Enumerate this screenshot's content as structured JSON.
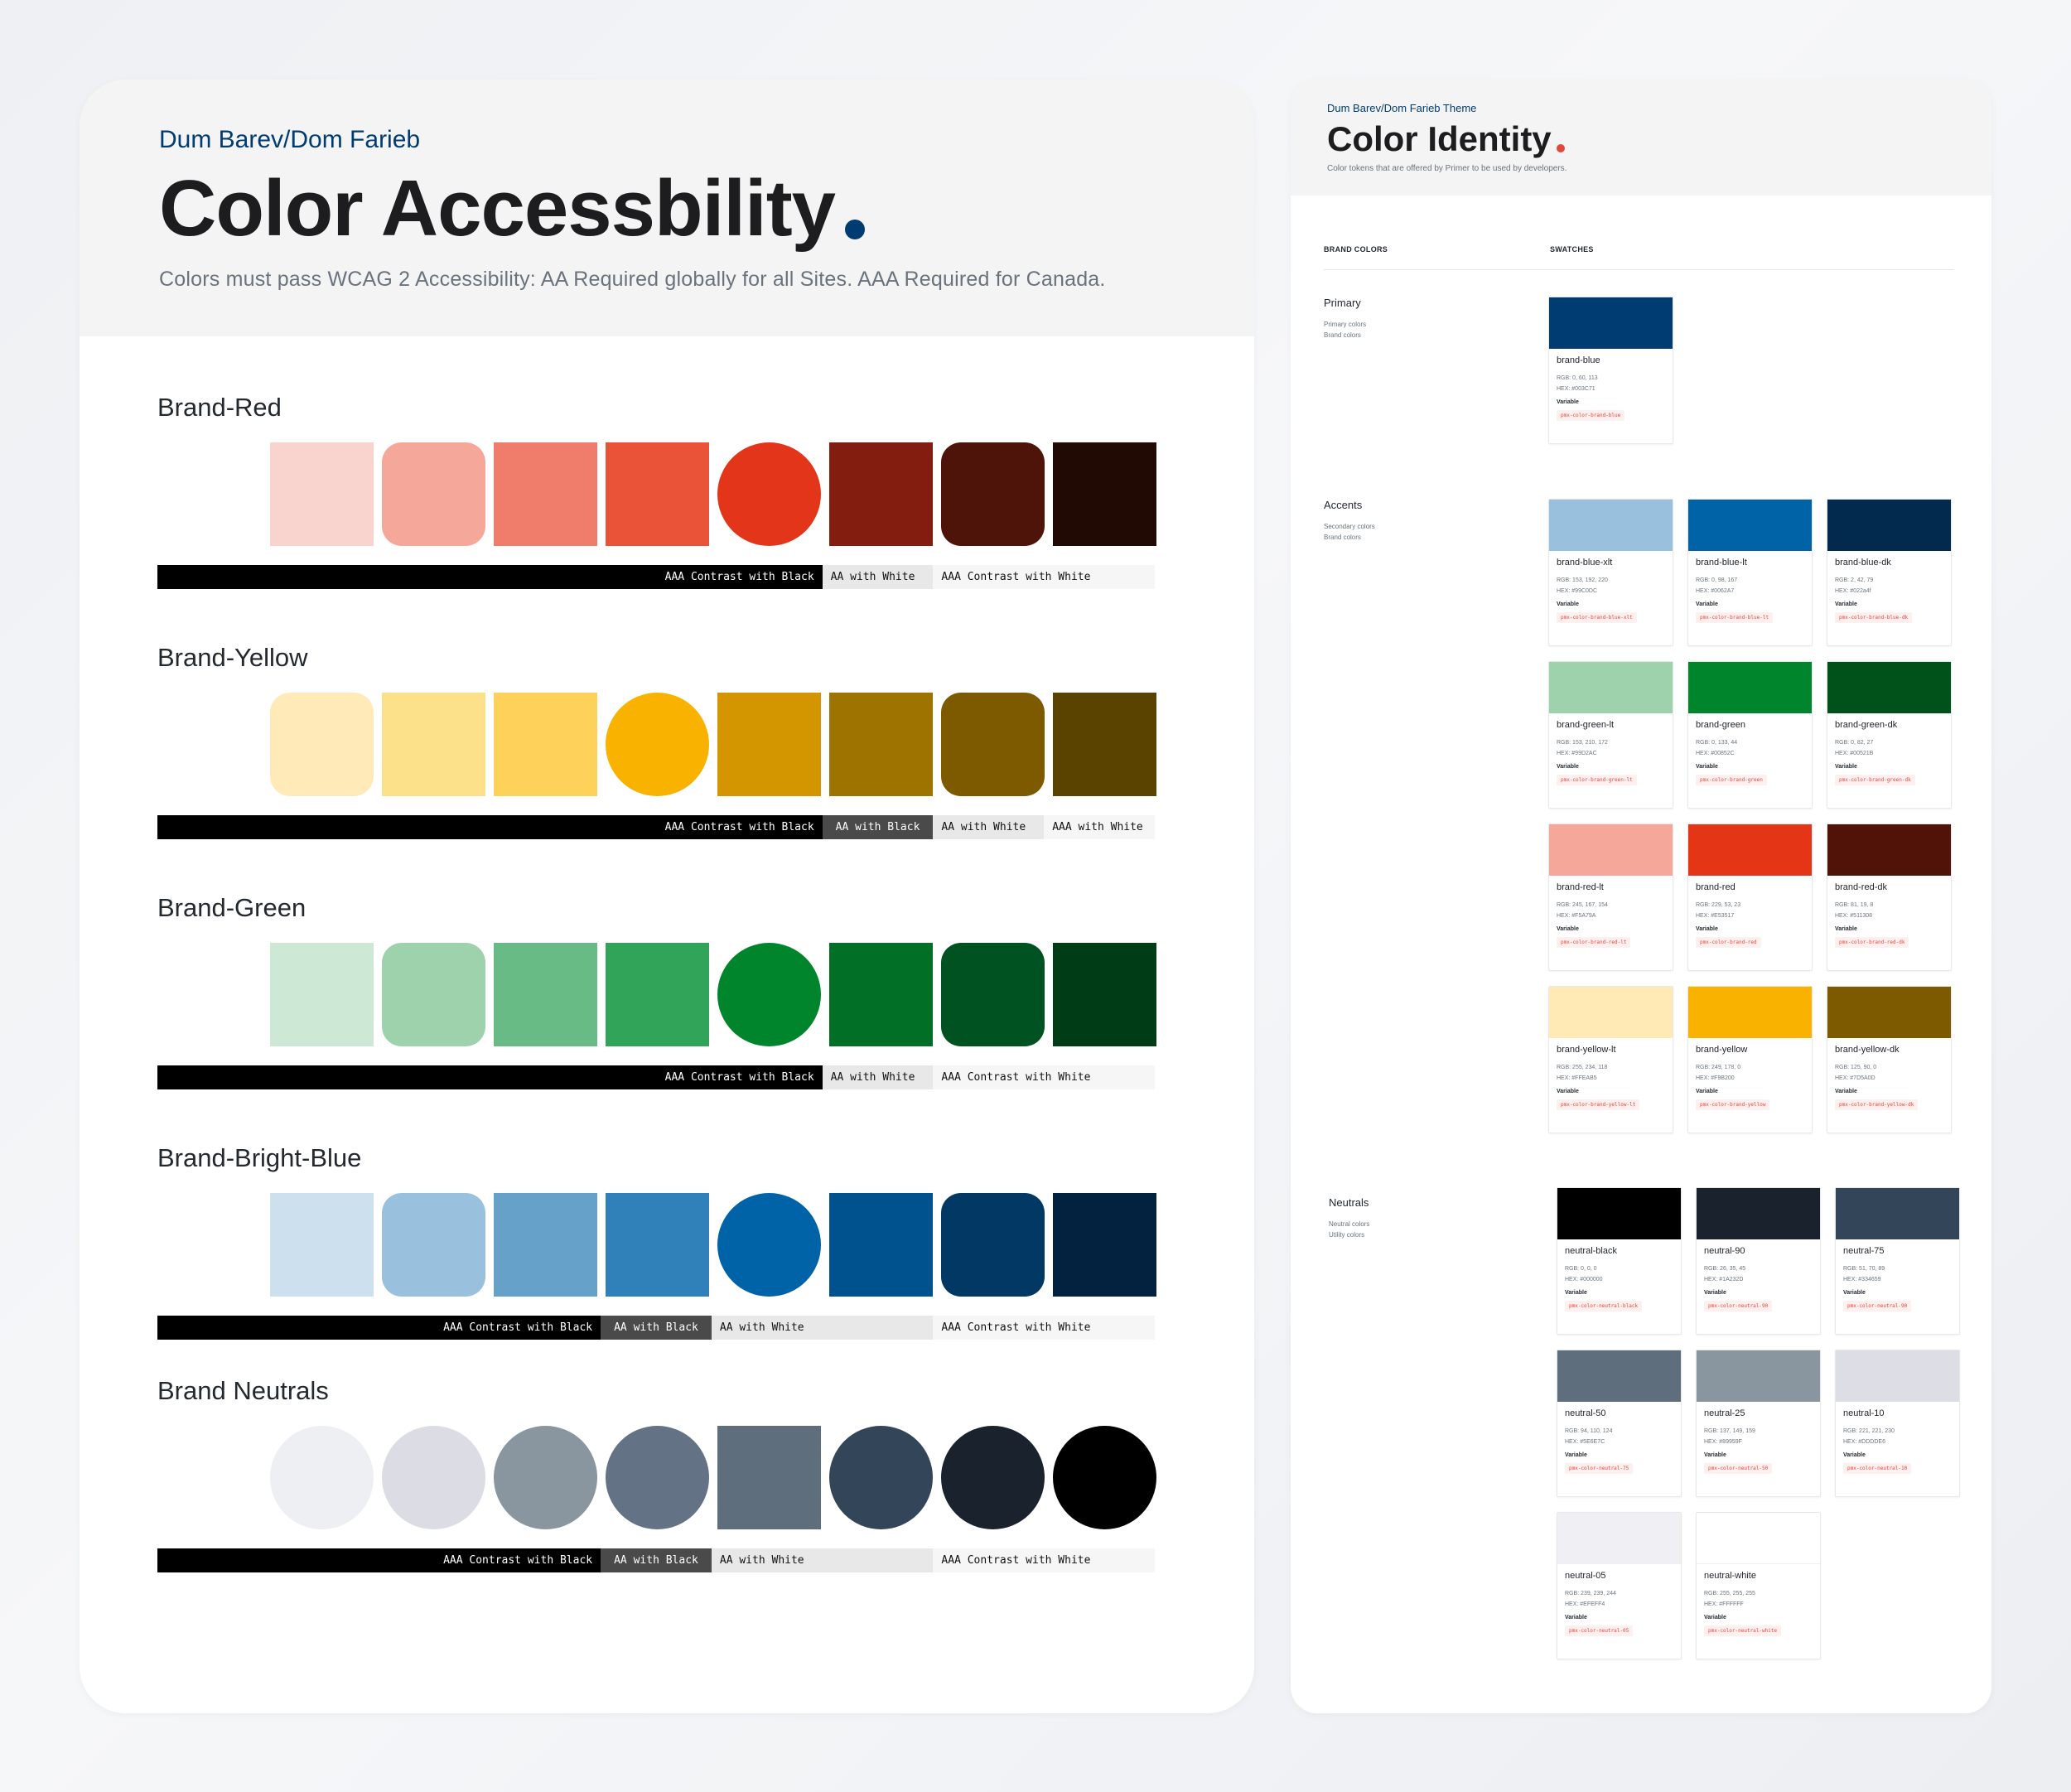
{
  "accessibility": {
    "kicker": "Dum Barev/Dom Farieb",
    "title": "Color Accessbility",
    "subtitle": "Colors must pass WCAG 2 Accessibility: AA Required globally for all Sites. AAA Required for Canada.",
    "groups": [
      {
        "title": "Brand-Red",
        "swatches": [
          {
            "color": "#f9d3ce",
            "shape": "square"
          },
          {
            "color": "#f5a799",
            "shape": "rounded"
          },
          {
            "color": "#f07d6b",
            "shape": "square"
          },
          {
            "color": "#ea5338",
            "shape": "square"
          },
          {
            "color": "#e3351a",
            "shape": "circle"
          },
          {
            "color": "#821d10",
            "shape": "square"
          },
          {
            "color": "#4e140a",
            "shape": "rounded"
          },
          {
            "color": "#220a04",
            "shape": "square"
          }
        ],
        "contrast": [
          {
            "label": "AAA Contrast with Black",
            "style": "black",
            "span": 6
          },
          {
            "label": "AA with White",
            "style": "lgray",
            "span": 1
          },
          {
            "label": "AAA Contrast with White",
            "style": "xlgray",
            "span": 2
          }
        ]
      },
      {
        "title": "Brand-Yellow",
        "swatches": [
          {
            "color": "#ffeab8",
            "shape": "rounded"
          },
          {
            "color": "#fde08a",
            "shape": "square"
          },
          {
            "color": "#fdd15a",
            "shape": "square"
          },
          {
            "color": "#f9b200",
            "shape": "circle"
          },
          {
            "color": "#d49600",
            "shape": "square"
          },
          {
            "color": "#9e7300",
            "shape": "square"
          },
          {
            "color": "#7d5a00",
            "shape": "rounded"
          },
          {
            "color": "#5a4200",
            "shape": "square"
          }
        ],
        "contrast": [
          {
            "label": "AAA Contrast with Black",
            "style": "black",
            "span": 6
          },
          {
            "label": "AA with Black",
            "style": "dgray",
            "span": 1
          },
          {
            "label": "AA with White",
            "style": "lgray",
            "span": 1
          },
          {
            "label": "AAA with White",
            "style": "xlgray",
            "span": 1
          }
        ]
      },
      {
        "title": "Brand-Green",
        "swatches": [
          {
            "color": "#cde9d6",
            "shape": "square"
          },
          {
            "color": "#9dd2ac",
            "shape": "rounded"
          },
          {
            "color": "#68bb84",
            "shape": "square"
          },
          {
            "color": "#32a45a",
            "shape": "square"
          },
          {
            "color": "#00852c",
            "shape": "circle"
          },
          {
            "color": "#026f26",
            "shape": "square"
          },
          {
            "color": "#005220",
            "shape": "rounded"
          },
          {
            "color": "#003d16",
            "shape": "square"
          }
        ],
        "contrast": [
          {
            "label": "AAA Contrast with Black",
            "style": "black",
            "span": 6
          },
          {
            "label": "AA with White",
            "style": "lgray",
            "span": 1
          },
          {
            "label": "AAA Contrast with White",
            "style": "xlgray",
            "span": 2
          }
        ]
      },
      {
        "title": "Brand-Bright-Blue",
        "swatches": [
          {
            "color": "#cde0ee",
            "shape": "square"
          },
          {
            "color": "#99c0dc",
            "shape": "rounded"
          },
          {
            "color": "#66a1c9",
            "shape": "square"
          },
          {
            "color": "#3081b9",
            "shape": "square"
          },
          {
            "color": "#0062a7",
            "shape": "circle"
          },
          {
            "color": "#00528e",
            "shape": "square"
          },
          {
            "color": "#023864",
            "shape": "rounded"
          },
          {
            "color": "#02223f",
            "shape": "square"
          }
        ],
        "contrast": [
          {
            "label": "AAA Contrast with Black",
            "style": "black",
            "span": 4
          },
          {
            "label": "AA with Black",
            "style": "dgray",
            "span": 1
          },
          {
            "label": "AA with White",
            "style": "lgray",
            "span": 2
          },
          {
            "label": "AAA Contrast with White",
            "style": "xlgray",
            "span": 2
          }
        ]
      },
      {
        "title": "Brand Neutrals",
        "swatches": [
          {
            "color": "#eeeff2",
            "shape": "circle"
          },
          {
            "color": "#dcdde4",
            "shape": "circle"
          },
          {
            "color": "#89959f",
            "shape": "circle"
          },
          {
            "color": "#637385",
            "shape": "circle"
          },
          {
            "color": "#5e6e7c",
            "shape": "square"
          },
          {
            "color": "#334659",
            "shape": "circle"
          },
          {
            "color": "#1a222d",
            "shape": "circle"
          },
          {
            "color": "#000000",
            "shape": "circle"
          }
        ],
        "contrast": [
          {
            "label": "AAA Contrast with Black",
            "style": "black",
            "span": 4
          },
          {
            "label": "AA with Black",
            "style": "dgray",
            "span": 1
          },
          {
            "label": "AA with White",
            "style": "lgray",
            "span": 2
          },
          {
            "label": "AAA Contrast with White",
            "style": "xlgray",
            "span": 2
          }
        ]
      }
    ]
  },
  "identity": {
    "kicker": "Dum Barev/Dom Farieb Theme",
    "title": "Color Identity",
    "description": "Color tokens that are offered by Primer to be used by developers.",
    "head_left": "BRAND COLORS",
    "head_right": "SWATCHES",
    "variable_label": "Variable",
    "sections": [
      {
        "label": "Primary",
        "sub1": "Primary colors",
        "sub2": "Brand colors",
        "cards": [
          {
            "name": "brand-blue",
            "rgb": "RGB: 0, 60, 113",
            "hex": "HEX: #003C71",
            "token": "pmx-color-brand-blue",
            "color": "#003c71",
            "border": false
          }
        ]
      },
      {
        "label": "Accents",
        "sub1": "Secondary colors",
        "sub2": "Brand colors",
        "cards": [
          {
            "name": "brand-blue-xlt",
            "rgb": "RGB: 153, 192, 220",
            "hex": "HEX: #99C0DC",
            "token": "pmx-color-brand-blue-xlt",
            "color": "#99c0dc",
            "border": false
          },
          {
            "name": "brand-blue-lt",
            "rgb": "RGB: 0, 98, 167",
            "hex": "HEX: #0062A7",
            "token": "pmx-color-brand-blue-lt",
            "color": "#0062a7",
            "border": false
          },
          {
            "name": "brand-blue-dk",
            "rgb": "RGB: 2, 42, 79",
            "hex": "HEX: #022a4f",
            "token": "pmx-color-brand-blue-dk",
            "color": "#022a4f",
            "border": false
          },
          {
            "name": "brand-green-lt",
            "rgb": "RGB: 153, 210, 172",
            "hex": "HEX: #99D2AC",
            "token": "pmx-color-brand-green-lt",
            "color": "#9dd2ac",
            "border": false
          },
          {
            "name": "brand-green",
            "rgb": "RGB: 0, 133, 44",
            "hex": "HEX: #00852C",
            "token": "pmx-color-brand-green",
            "color": "#00852c",
            "border": false
          },
          {
            "name": "brand-green-dk",
            "rgb": "RGB: 0, 82, 27",
            "hex": "HEX: #00521B",
            "token": "pmx-color-brand-green-dk",
            "color": "#00521b",
            "border": false
          },
          {
            "name": "brand-red-lt",
            "rgb": "RGB: 245, 167, 154",
            "hex": "HEX: #F5A79A",
            "token": "pmx-color-brand-red-lt",
            "color": "#f5a79a",
            "border": false
          },
          {
            "name": "brand-red",
            "rgb": "RGB: 229, 53, 23",
            "hex": "HEX: #E53517",
            "token": "pmx-color-brand-red",
            "color": "#e53517",
            "border": false
          },
          {
            "name": "brand-red-dk",
            "rgb": "RGB: 81, 19, 8",
            "hex": "HEX: #511308",
            "token": "pmx-color-brand-red-dk",
            "color": "#511308",
            "border": false
          },
          {
            "name": "brand-yellow-lt",
            "rgb": "RGB: 255, 234, 1‍18",
            "hex": "HEX: #FFEAB5",
            "token": "pmx-color-brand-yellow-lt",
            "color": "#ffeab5",
            "border": false
          },
          {
            "name": "brand-yellow",
            "rgb": "RGB: 249, 178, 0",
            "hex": "HEX: #F9B200",
            "token": "pmx-color-brand-yellow",
            "color": "#f9b200",
            "border": false
          },
          {
            "name": "brand-yellow-dk",
            "rgb": "RGB: 125, 90, 0",
            "hex": "HEX: #7D5A0D",
            "token": "pmx-color-brand-yellow-dk",
            "color": "#7d5a00",
            "border": false
          }
        ]
      },
      {
        "label": "Neutrals",
        "sub1": "Neutral colors",
        "sub2": "Utility colors",
        "cards": [
          {
            "name": "neutral-black",
            "rgb": "RGB: 0, 0, 0",
            "hex": "HEX: #000000",
            "token": "pmx-color-neutral-black",
            "color": "#000000",
            "border": false
          },
          {
            "name": "neutral-90",
            "rgb": "RGB: 26, 35, 45",
            "hex": "HEX: #1A232D",
            "token": "pmx-color-neutral-90",
            "color": "#1a232d",
            "border": false
          },
          {
            "name": "neutral-75",
            "rgb": "RGB: 51, 70, 89",
            "hex": "HEX: #334659",
            "token": "pmx-color-neutral-90",
            "color": "#334659",
            "border": false
          },
          {
            "name": "neutral-50",
            "rgb": "RGB: 94, 110, 124",
            "hex": "HEX: #5E6E7C",
            "token": "pmx-color-neutral-75",
            "color": "#5e6e7c",
            "border": false
          },
          {
            "name": "neutral-25",
            "rgb": "RGB: 137, 149, 159",
            "hex": "HEX: #89959F",
            "token": "pmx-color-neutral-50",
            "color": "#89959f",
            "border": false
          },
          {
            "name": "neutral-10",
            "rgb": "RGB: 221, 221, 230",
            "hex": "HEX: #DDDDE6",
            "token": "pmx-color-neutral-10",
            "color": "#dddde6",
            "border": false
          },
          {
            "name": "neutral-05",
            "rgb": "RGB: 239, 239, 244",
            "hex": "HEX: #EFEFF4",
            "token": "pmx-color-neutral-05",
            "color": "#efeff4",
            "border": false
          },
          {
            "name": "neutral-white",
            "rgb": "RGB: 255, 255, 255",
            "hex": "HEX: #FFFFFF",
            "token": "pmx-color-neutral-white",
            "color": "#ffffff",
            "border": true
          }
        ]
      }
    ]
  }
}
